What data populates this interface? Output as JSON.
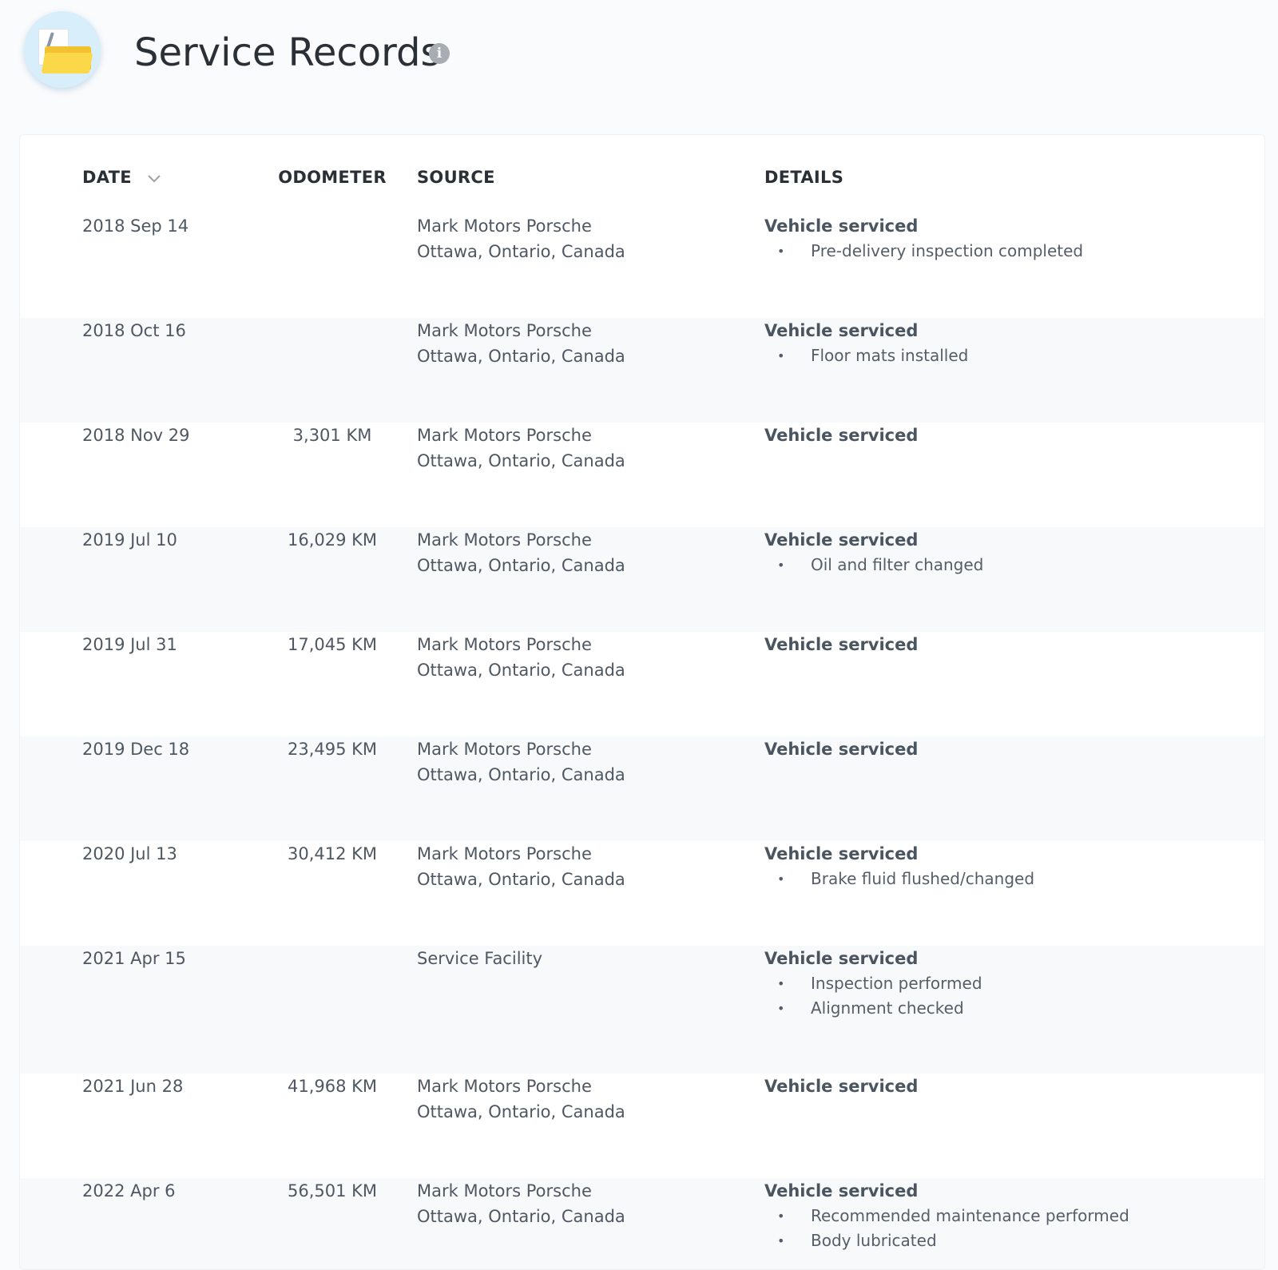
{
  "header": {
    "title": "Service Records",
    "info_icon_glyph": "i"
  },
  "table": {
    "columns": {
      "date": "DATE",
      "odometer": "ODOMETER",
      "source": "SOURCE",
      "details": "DETAILS"
    },
    "sort": {
      "column": "date",
      "direction": "descending",
      "icon": "chevron-down-icon"
    },
    "rows": [
      {
        "date": "2018 Sep 14",
        "odometer": "",
        "source_name": "Mark Motors Porsche",
        "source_location": "Ottawa, Ontario, Canada",
        "detail_title": "Vehicle serviced",
        "detail_items": [
          "Pre-delivery inspection completed"
        ]
      },
      {
        "date": "2018 Oct 16",
        "odometer": "",
        "source_name": "Mark Motors Porsche",
        "source_location": "Ottawa, Ontario, Canada",
        "detail_title": "Vehicle serviced",
        "detail_items": [
          "Floor mats installed"
        ]
      },
      {
        "date": "2018 Nov 29",
        "odometer": "3,301 KM",
        "source_name": "Mark Motors Porsche",
        "source_location": "Ottawa, Ontario, Canada",
        "detail_title": "Vehicle serviced",
        "detail_items": []
      },
      {
        "date": "2019 Jul 10",
        "odometer": "16,029 KM",
        "source_name": "Mark Motors Porsche",
        "source_location": "Ottawa, Ontario, Canada",
        "detail_title": "Vehicle serviced",
        "detail_items": [
          "Oil and filter changed"
        ]
      },
      {
        "date": "2019 Jul 31",
        "odometer": "17,045 KM",
        "source_name": "Mark Motors Porsche",
        "source_location": "Ottawa, Ontario, Canada",
        "detail_title": "Vehicle serviced",
        "detail_items": []
      },
      {
        "date": "2019 Dec 18",
        "odometer": "23,495 KM",
        "source_name": "Mark Motors Porsche",
        "source_location": "Ottawa, Ontario, Canada",
        "detail_title": "Vehicle serviced",
        "detail_items": []
      },
      {
        "date": "2020 Jul 13",
        "odometer": "30,412 KM",
        "source_name": "Mark Motors Porsche",
        "source_location": "Ottawa, Ontario, Canada",
        "detail_title": "Vehicle serviced",
        "detail_items": [
          "Brake fluid flushed/changed"
        ]
      },
      {
        "date": "2021 Apr 15",
        "odometer": "",
        "source_name": "Service Facility",
        "source_location": "",
        "detail_title": "Vehicle serviced",
        "detail_items": [
          "Inspection performed",
          "Alignment checked"
        ]
      },
      {
        "date": "2021 Jun 28",
        "odometer": "41,968 KM",
        "source_name": "Mark Motors Porsche",
        "source_location": "Ottawa, Ontario, Canada",
        "detail_title": "Vehicle serviced",
        "detail_items": []
      },
      {
        "date": "2022 Apr 6",
        "odometer": "56,501 KM",
        "source_name": "Mark Motors Porsche",
        "source_location": "Ottawa, Ontario, Canada",
        "detail_title": "Vehicle serviced",
        "detail_items": [
          "Recommended maintenance performed",
          "Body lubricated"
        ]
      }
    ]
  },
  "colors": {
    "page_background": "#fafbfc",
    "card_background": "#ffffff",
    "row_alternate": "#f7f9fb",
    "heading_text": "#2b3036",
    "body_text": "#4f5862",
    "info_icon": "#a7adb3",
    "folder_accent": "#fbd84a",
    "logo_circle": "#d9eefb"
  }
}
